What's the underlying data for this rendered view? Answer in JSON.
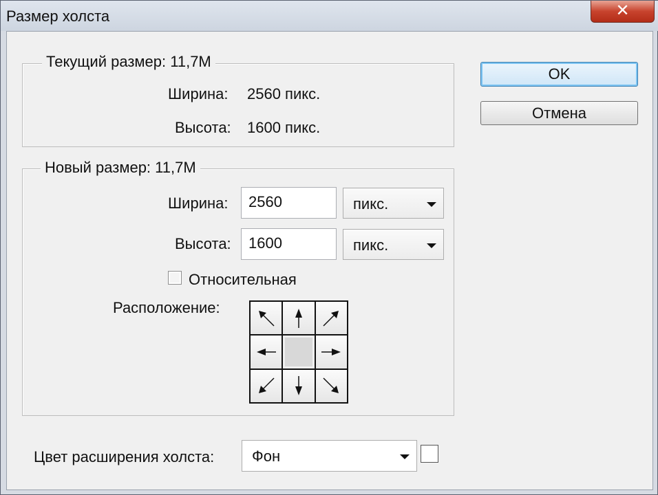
{
  "window": {
    "title": "Размер холста",
    "close_label": "✕"
  },
  "current_size": {
    "legend": "Текущий размер:",
    "value": "11,7M",
    "width_label": "Ширина:",
    "width_value": "2560 пикс.",
    "height_label": "Высота:",
    "height_value": "1600 пикс."
  },
  "new_size": {
    "legend": "Новый размер:",
    "value": "11,7M",
    "width_label": "Ширина:",
    "width_value": "2560",
    "width_unit": "пикс.",
    "height_label": "Высота:",
    "height_value": "1600",
    "height_unit": "пикс.",
    "relative_label": "Относительная",
    "relative_checked": false,
    "anchor_label": "Расположение:",
    "anchor_selected": "center",
    "anchor_icons": [
      "arrow-up-left-icon",
      "arrow-up-icon",
      "arrow-up-right-icon",
      "arrow-left-icon",
      "anchor-center",
      "arrow-right-icon",
      "arrow-down-left-icon",
      "arrow-down-icon",
      "arrow-down-right-icon"
    ]
  },
  "extension": {
    "label": "Цвет расширения холста:",
    "value": "Фон",
    "swatch_color": "#ffffff"
  },
  "buttons": {
    "ok": "OK",
    "cancel": "Отмена"
  }
}
